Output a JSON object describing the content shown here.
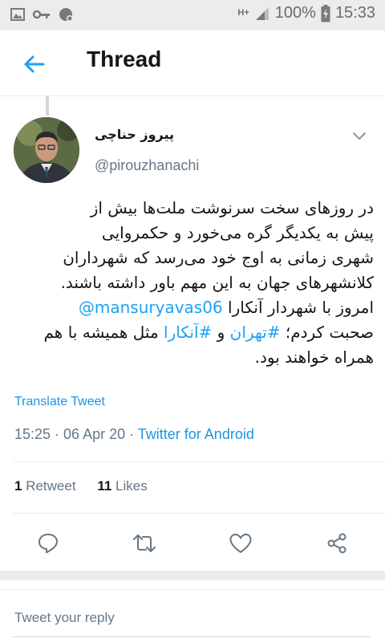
{
  "status_bar": {
    "network": "H+",
    "battery_percent": "100%",
    "time": "15:33"
  },
  "header": {
    "title": "Thread"
  },
  "tweet": {
    "author_name": "پیروز حناچی",
    "handle": "@pirouzhanachi",
    "text_lines": [
      "در روزهای سخت سرنوشت ملت‌ها بیش از",
      "پیش به یکدیگر گره می‌خورد و حکمروایی",
      "شهری زمانی به اوج خود می‌رسد که شهرداران",
      "کلانشهرهای جهان به این مهم باور داشته باشند."
    ],
    "line5_text": "امروز با شهردار آنکارا",
    "line5_mention": "@mansuryavas06",
    "line6_pre": "صحبت کردم؛",
    "line6_tag1": "#تهران",
    "line6_mid": "و",
    "line6_tag2": "#آنکارا",
    "line6_post": "مثل همیشه با هم",
    "line7": "همراه خواهند بود.",
    "translate_label": "Translate Tweet",
    "timestamp": "15:25 · 06 Apr 20 · ",
    "source": "Twitter for Android",
    "retweets_count": "1",
    "retweets_label": "Retweet",
    "likes_count": "11",
    "likes_label": "Likes"
  },
  "reply": {
    "placeholder": "Tweet your reply"
  },
  "icons": {
    "back": "arrow-left-icon",
    "caret": "chevron-down-icon",
    "reply": "speech-bubble-icon",
    "retweet": "retweet-icon",
    "like": "heart-icon",
    "share": "share-icon"
  },
  "colors": {
    "accent": "#1da1f2",
    "link": "#1b95e0",
    "secondary_text": "#657786",
    "primary_text": "#14171a",
    "divider": "#e6ecf0"
  }
}
